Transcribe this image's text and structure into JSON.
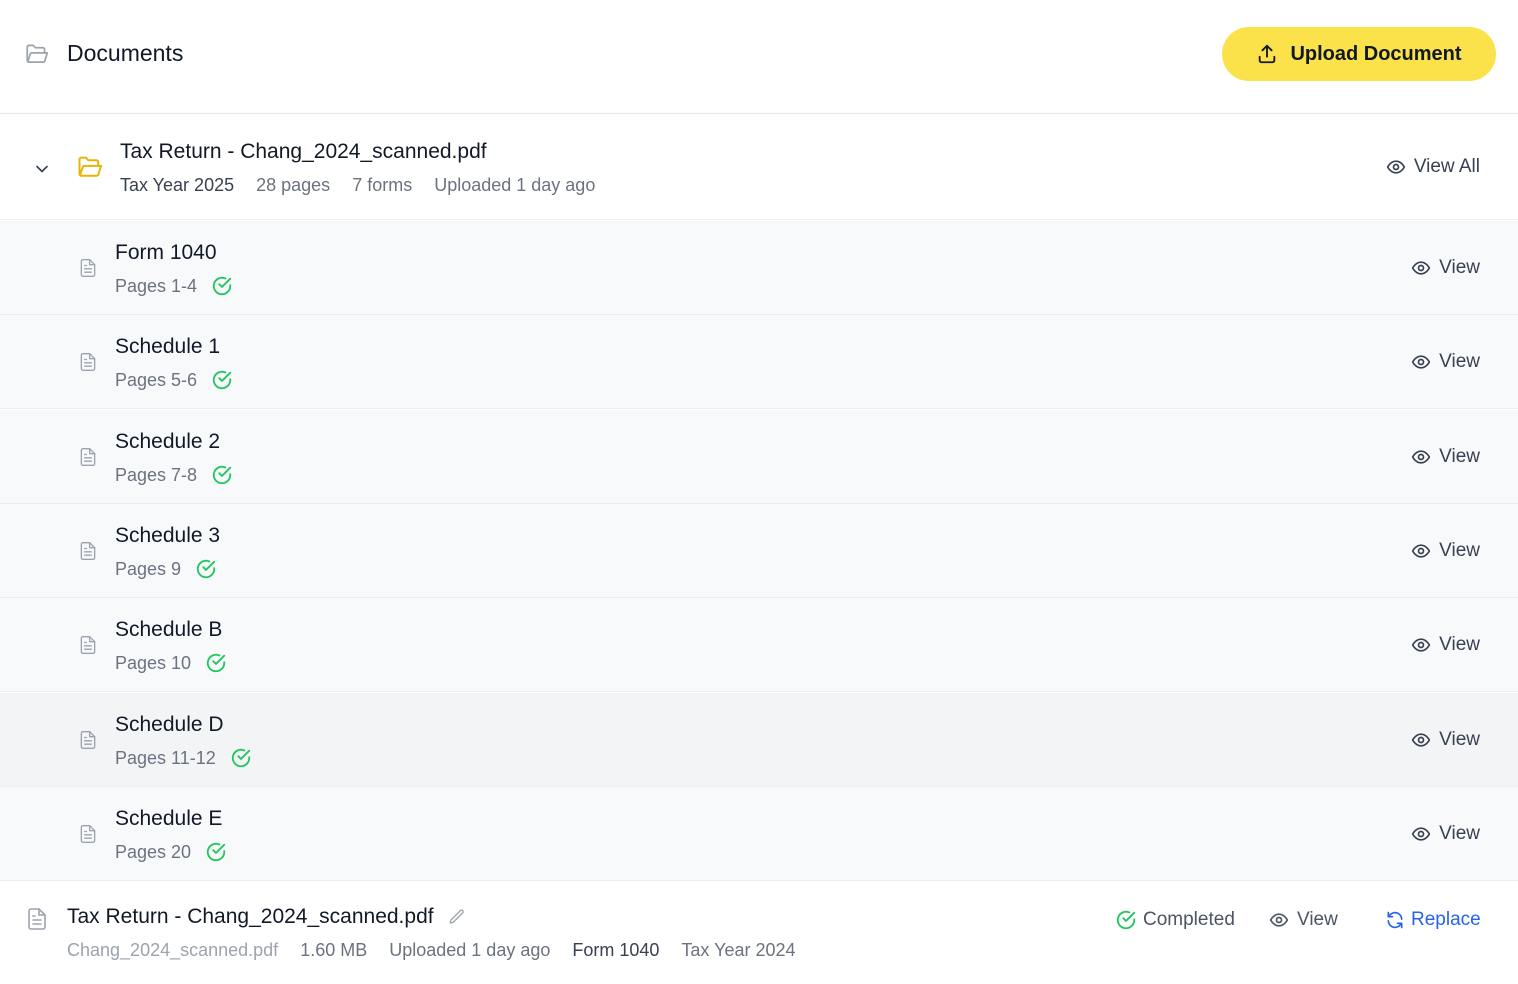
{
  "header": {
    "title": "Documents",
    "upload_label": "Upload Document",
    "accent_color": "#fbe14a"
  },
  "group": {
    "title": "Tax Return - Chang_2024_scanned.pdf",
    "tax_year": "Tax Year 2025",
    "pages": "28 pages",
    "forms": "7 forms",
    "uploaded": "Uploaded 1 day ago",
    "view_all_label": "View All",
    "expanded": true,
    "folder_color": "#eab308"
  },
  "forms": [
    {
      "name": "Form 1040",
      "pages": "Pages 1-4",
      "status": "check",
      "view_label": "View"
    },
    {
      "name": "Schedule 1",
      "pages": "Pages 5-6",
      "status": "check",
      "view_label": "View"
    },
    {
      "name": "Schedule 2",
      "pages": "Pages 7-8",
      "status": "check",
      "view_label": "View"
    },
    {
      "name": "Schedule 3",
      "pages": "Pages 9",
      "status": "check",
      "view_label": "View"
    },
    {
      "name": "Schedule B",
      "pages": "Pages 10",
      "status": "check",
      "view_label": "View"
    },
    {
      "name": "Schedule D",
      "pages": "Pages 11-12",
      "status": "check",
      "view_label": "View",
      "highlighted": true
    },
    {
      "name": "Schedule E",
      "pages": "Pages 20",
      "status": "check",
      "view_label": "View"
    }
  ],
  "file": {
    "title": "Tax Return - Chang_2024_scanned.pdf",
    "filename": "Chang_2024_scanned.pdf",
    "size": "1.60 MB",
    "uploaded": "Uploaded 1 day ago",
    "form": "Form 1040",
    "tax_year": "Tax Year 2024",
    "status_label": "Completed",
    "view_label": "View",
    "replace_label": "Replace",
    "status_color": "#22c55e",
    "link_color": "#2563eb"
  }
}
